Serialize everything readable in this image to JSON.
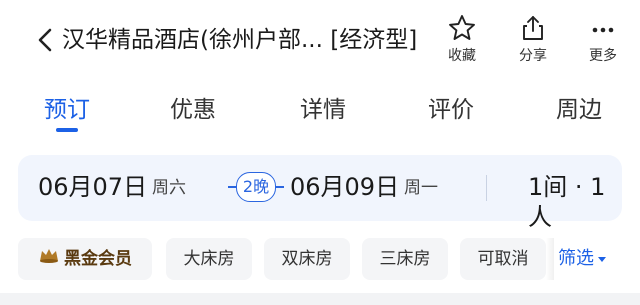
{
  "header": {
    "title": "汉华精品酒店(徐州户部... [经济型]",
    "actions": [
      {
        "label": "收藏",
        "icon": "star-icon"
      },
      {
        "label": "分享",
        "icon": "share-icon"
      },
      {
        "label": "更多",
        "icon": "more-icon"
      }
    ]
  },
  "tabs": [
    {
      "label": "预订",
      "active": true
    },
    {
      "label": "优惠",
      "active": false
    },
    {
      "label": "详情",
      "active": false
    },
    {
      "label": "评价",
      "active": false
    },
    {
      "label": "周边",
      "active": false
    }
  ],
  "booking": {
    "checkin_date": "06月07日",
    "checkin_weekday": "周六",
    "nights": "2晚",
    "checkout_date": "06月09日",
    "checkout_weekday": "周一",
    "rooms_guests": "1间 · 1人"
  },
  "filters": {
    "chips": [
      "黑金会员",
      "大床房",
      "双床房",
      "三床房",
      "可取消"
    ],
    "filter_label": "筛选"
  },
  "colors": {
    "accent": "#1c61e6",
    "datebar_bg": "#f1f5fd",
    "chip_bg": "#f4f5f7",
    "vip_text": "#5a3a10"
  }
}
